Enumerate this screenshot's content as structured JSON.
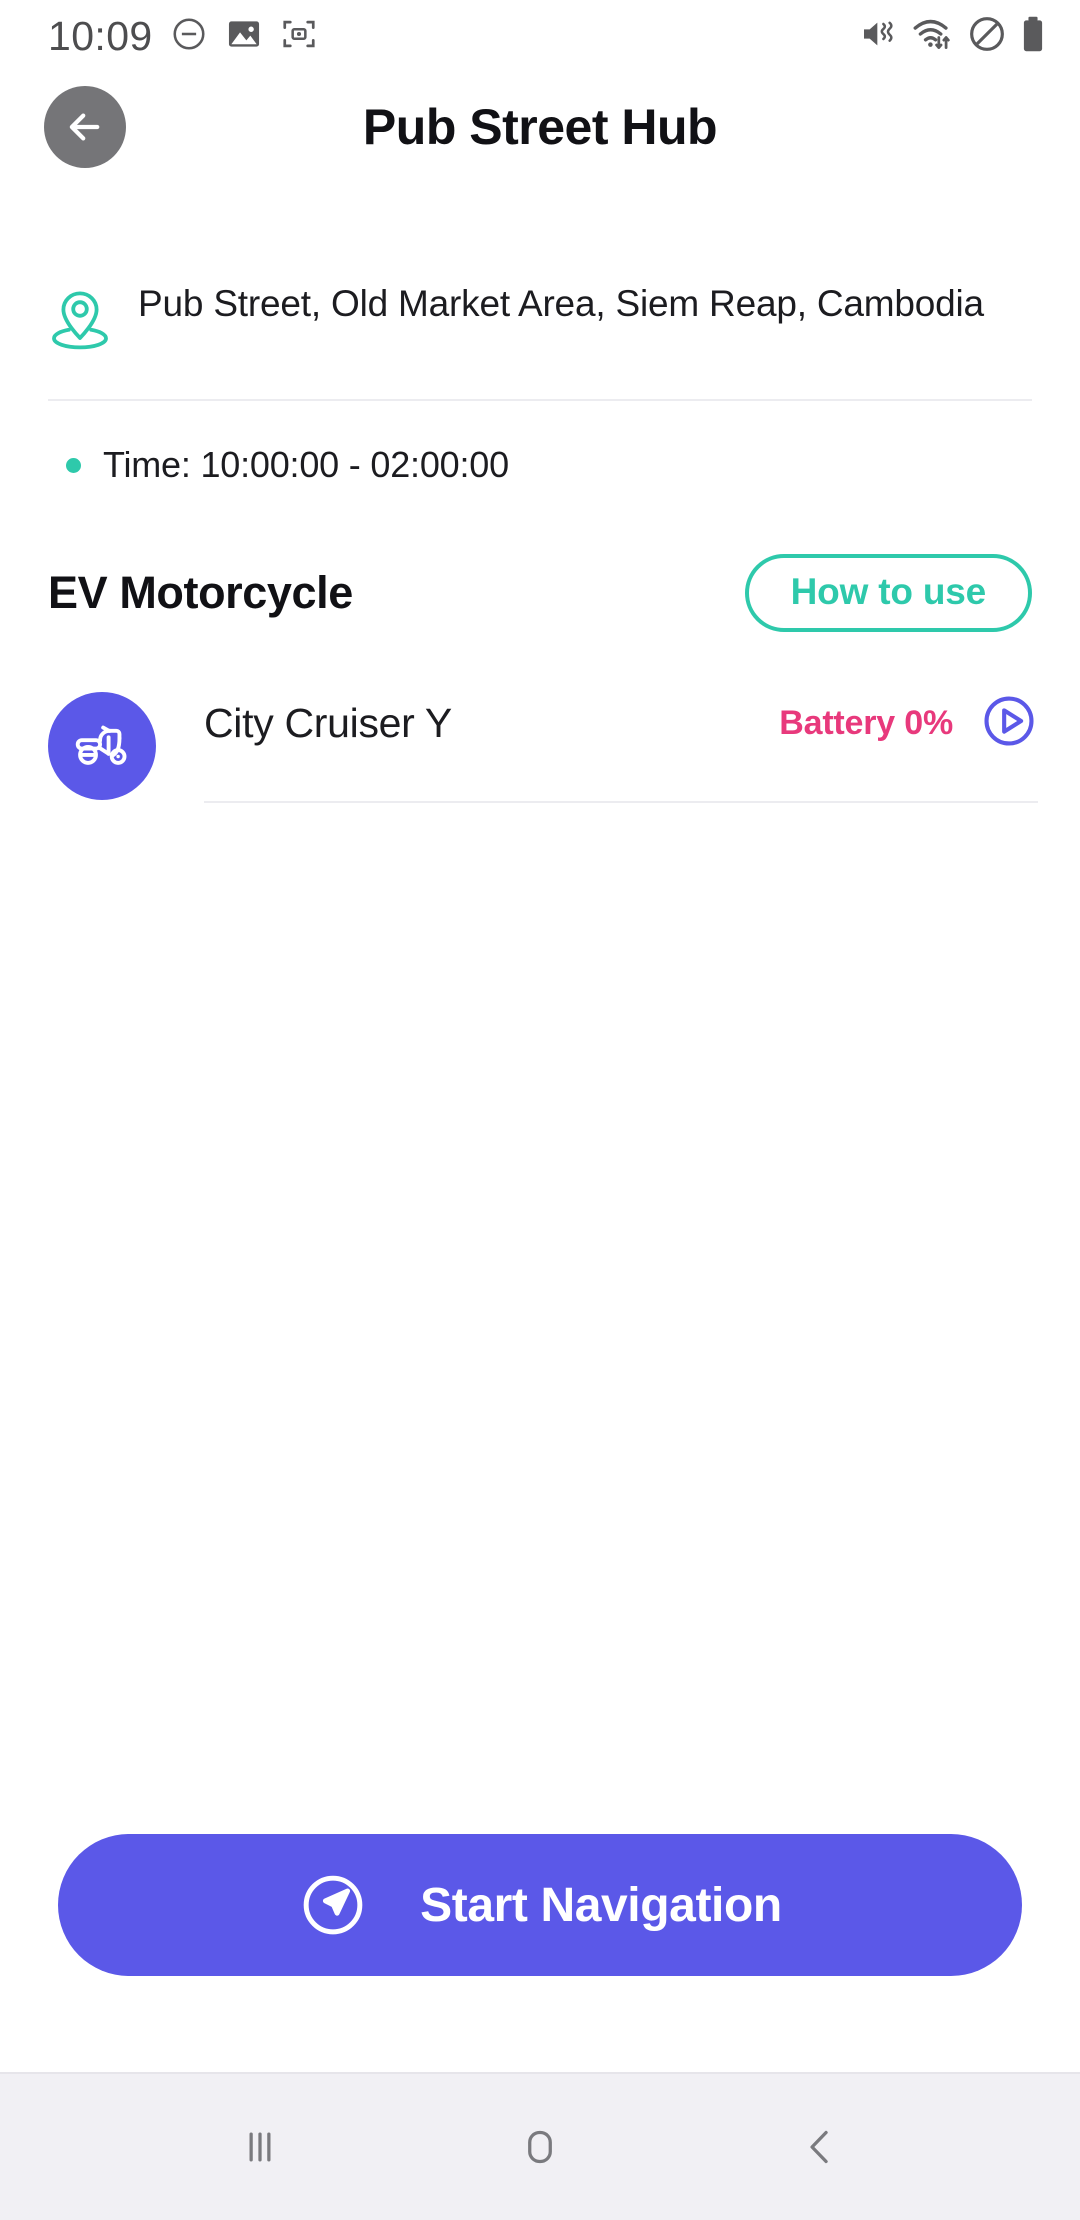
{
  "status_bar": {
    "clock": "10:09",
    "left_icons": [
      "do-not-disturb-minus-icon",
      "image-icon",
      "screenshot-capture-icon"
    ],
    "right_icons": [
      "mute-vibrate-icon",
      "wifi-data-transfer-icon",
      "no-entry-icon",
      "battery-icon"
    ]
  },
  "header": {
    "back_label": "back-arrow",
    "title": "Pub Street Hub"
  },
  "details": {
    "address": "Pub Street, Old Market Area, Siem Reap, Cambodia",
    "time": "Time: 10:00:00 - 02:00:00"
  },
  "section": {
    "title": "EV Motorcycle",
    "how_to_use": "How to use"
  },
  "vehicle": {
    "name": "City Cruiser Y",
    "battery": "Battery 0%",
    "play_icon": "play-circle-icon"
  },
  "cta": {
    "label": "Start Navigation",
    "icon": "navigation-arrow-icon"
  },
  "nav_bar": {
    "recents": "recents-button",
    "home": "home-button",
    "back": "back-button"
  },
  "colors": {
    "accent_teal": "#2ec9ab",
    "accent_indigo": "#5b58e8",
    "battery_pink": "#e8397c",
    "status_gray": "#4d4d4f",
    "navbar_bg": "#f1f0f4"
  }
}
